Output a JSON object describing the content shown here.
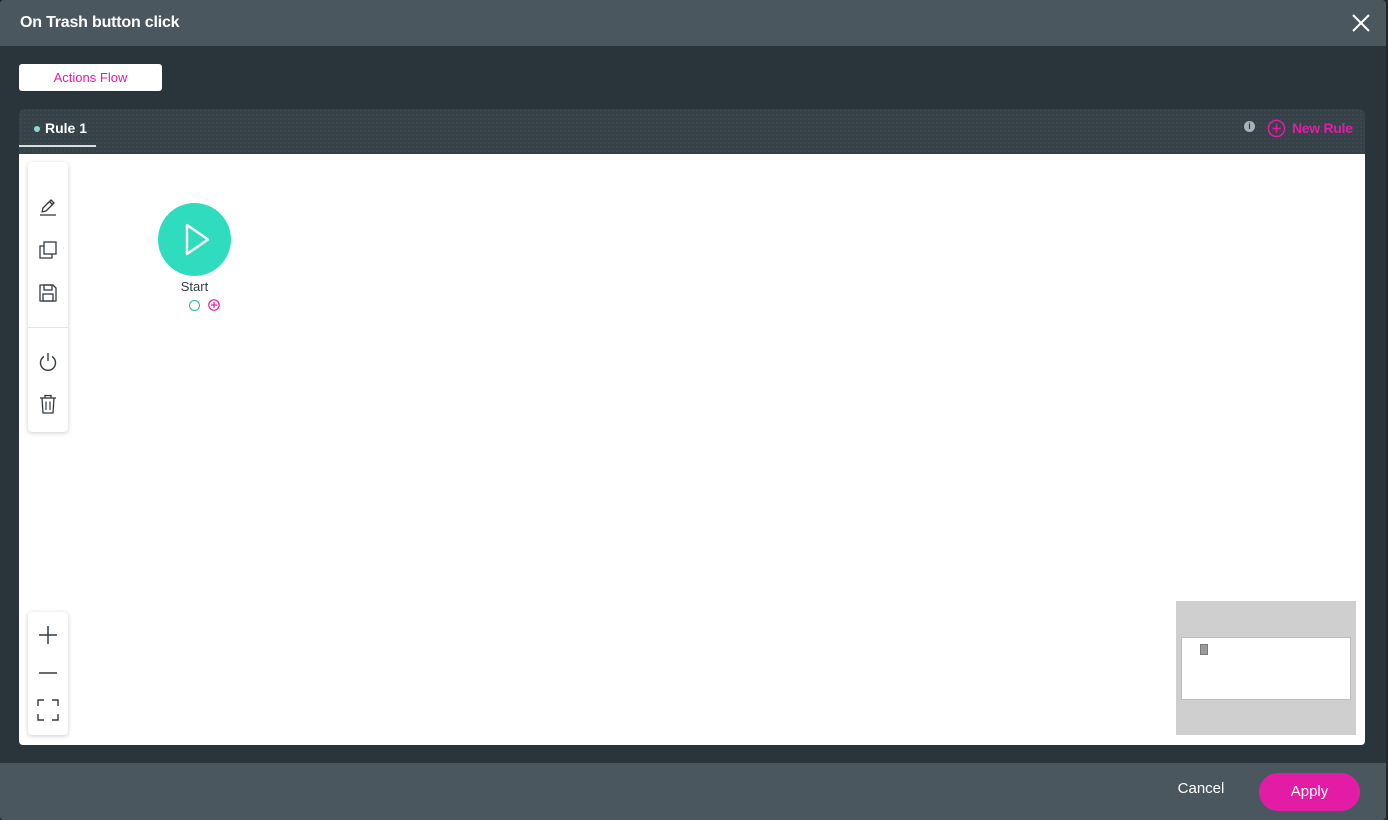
{
  "dialog": {
    "title": "On Trash button click",
    "close_icon": "close-icon"
  },
  "tabs": {
    "actions_flow_label": "Actions Flow"
  },
  "rules": {
    "active_rule_label": "Rule 1",
    "info_icon": "info-icon",
    "info_glyph": "i",
    "new_rule_label": "New Rule",
    "new_rule_icon": "plus-circle-icon"
  },
  "toolbar": {
    "items": [
      "pencil-icon",
      "copy-icon",
      "save-icon",
      "power-icon",
      "trash-icon"
    ]
  },
  "zoom": {
    "items": [
      "zoom-in-icon",
      "zoom-out-icon",
      "fit-screen-icon"
    ]
  },
  "flow": {
    "start_node_label": "Start",
    "start_icon": "play-icon"
  },
  "footer": {
    "cancel_label": "Cancel",
    "apply_label": "Apply"
  },
  "colors": {
    "accent": "#e21ca5",
    "start_node": "#2fdcbd",
    "header_bg": "#4b575f",
    "modal_bg": "#2a343b"
  }
}
